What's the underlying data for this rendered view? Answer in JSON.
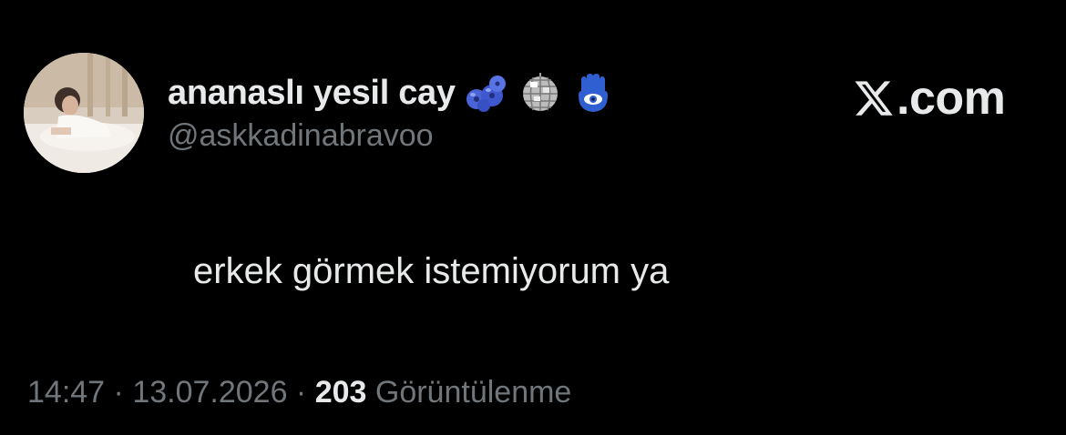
{
  "user": {
    "display_name": "ananaslı yesil cay",
    "handle": "@askkadinabravoo",
    "badges": [
      "blueberries-emoji",
      "mirror-ball-emoji",
      "hamsa-emoji"
    ]
  },
  "brand": {
    "suffix": ".com",
    "icon": "x-logo-icon"
  },
  "tweet": {
    "text": "erkek görmek istemiyorum ya"
  },
  "meta": {
    "time": "14:47",
    "separator1": " · ",
    "date": "13.07.2026",
    "separator2": " · ",
    "views_count": "203",
    "views_label": " Görüntülenme"
  },
  "colors": {
    "background": "#000000",
    "primary_text": "#e7e9ea",
    "secondary_text": "#71767b"
  }
}
